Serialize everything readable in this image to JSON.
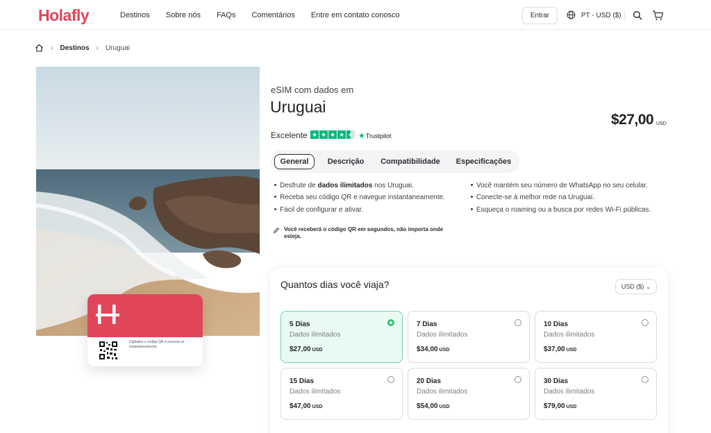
{
  "nav": {
    "logo": "Holafly",
    "links": [
      "Destinos",
      "Sobre nós",
      "FAQs",
      "Comentários",
      "Entre em contato conosco"
    ],
    "login_label": "Entrar",
    "locale_label": "PT - USD ($)",
    "icons": [
      "globe-icon",
      "search-icon",
      "cart-icon"
    ]
  },
  "breadcrumb": {
    "items": [
      "Destinos",
      "Uruguai"
    ]
  },
  "hero": {
    "card_caption": "Digitalize o código QR e conecte-se instantaneamente"
  },
  "product": {
    "subtitle": "eSIM com dados em",
    "title": "Uruguai",
    "price": "$27,00",
    "price_currency": "USD",
    "rating_label": "Excelente",
    "rating_stars": 4.5,
    "rating_source": "Trustpilot"
  },
  "tabs": [
    "General",
    "Descrição",
    "Compatibilidade",
    "Especificações"
  ],
  "active_tab": "General",
  "features": {
    "left_1_pre": "Desfrute de ",
    "left_1_bold": "dados ilimitados",
    "left_1_post": " nos Uruguai.",
    "left_2": "Receba seu código QR e navegue instantaneamente.",
    "left_3": "Fácil de configurar e ativar.",
    "right_1": "Você mantém seu número de WhatsApp no seu celular.",
    "right_2": "Conecte-se à melhor rede na Uruguai.",
    "right_3": "Esqueça o roaming ou a busca por redes Wi-Fi públicas."
  },
  "qr_note": "Você receberá o código QR em segundos, não importa onde esteja.",
  "plans_section": {
    "question": "Quantos dias você viaja?",
    "currency_select": "USD ($)",
    "plans": [
      {
        "days": "5 Dias",
        "data": "Dados ilimitados",
        "price": "$27,00",
        "currency": "USD",
        "selected": true
      },
      {
        "days": "7 Dias",
        "data": "Dados ilimitados",
        "price": "$34,00",
        "currency": "USD",
        "selected": false
      },
      {
        "days": "10 Dias",
        "data": "Dados ilimitados",
        "price": "$37,00",
        "currency": "USD",
        "selected": false
      },
      {
        "days": "15 Dias",
        "data": "Dados ilimitados",
        "price": "$47,00",
        "currency": "USD",
        "selected": false
      },
      {
        "days": "20 Dias",
        "data": "Dados ilimitados",
        "price": "$54,00",
        "currency": "USD",
        "selected": false
      },
      {
        "days": "30 Dias",
        "data": "Dados ilimitados",
        "price": "$79,00",
        "currency": "USD",
        "selected": false
      }
    ]
  },
  "colors": {
    "brand": "#e1455a",
    "selected_border": "#6fd3a4",
    "selected_bg": "#e9faf2",
    "trustpilot_green": "#00b67a"
  }
}
